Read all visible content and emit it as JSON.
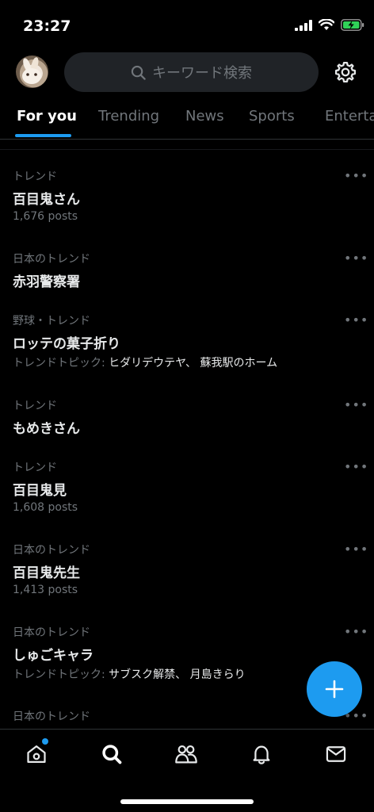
{
  "status_bar": {
    "time": "23:27"
  },
  "header": {
    "search_placeholder": "キーワード検索"
  },
  "tabs": [
    {
      "label": "For you"
    },
    {
      "label": "Trending"
    },
    {
      "label": "News"
    },
    {
      "label": "Sports"
    },
    {
      "label": "Entertainment"
    }
  ],
  "trends": [
    {
      "context": "トレンド",
      "name": "百目鬼さん",
      "posts": "1,676 posts"
    },
    {
      "context": "日本のトレンド",
      "name": "赤羽警察署"
    },
    {
      "context": "野球・トレンド",
      "name": "ロッテの菓子折り",
      "topic_label": "トレンドトピック:",
      "topic_value": "ヒダリデウテヤ、 蘇我駅のホーム"
    },
    {
      "context": "トレンド",
      "name": "もめきさん"
    },
    {
      "context": "トレンド",
      "name": "百目鬼見",
      "posts": "1,608 posts"
    },
    {
      "context": "日本のトレンド",
      "name": "百目鬼先生",
      "posts": "1,413 posts"
    },
    {
      "context": "日本のトレンド",
      "name": "しゅごキャラ",
      "topic_label": "トレンドトピック:",
      "topic_value": "サブスク解禁、 月島きらり"
    },
    {
      "context": "日本のトレンド"
    }
  ],
  "more_glyph": "•••",
  "colors": {
    "accent": "#1d9bf0",
    "background": "#000000",
    "secondary_text": "#71767b"
  }
}
